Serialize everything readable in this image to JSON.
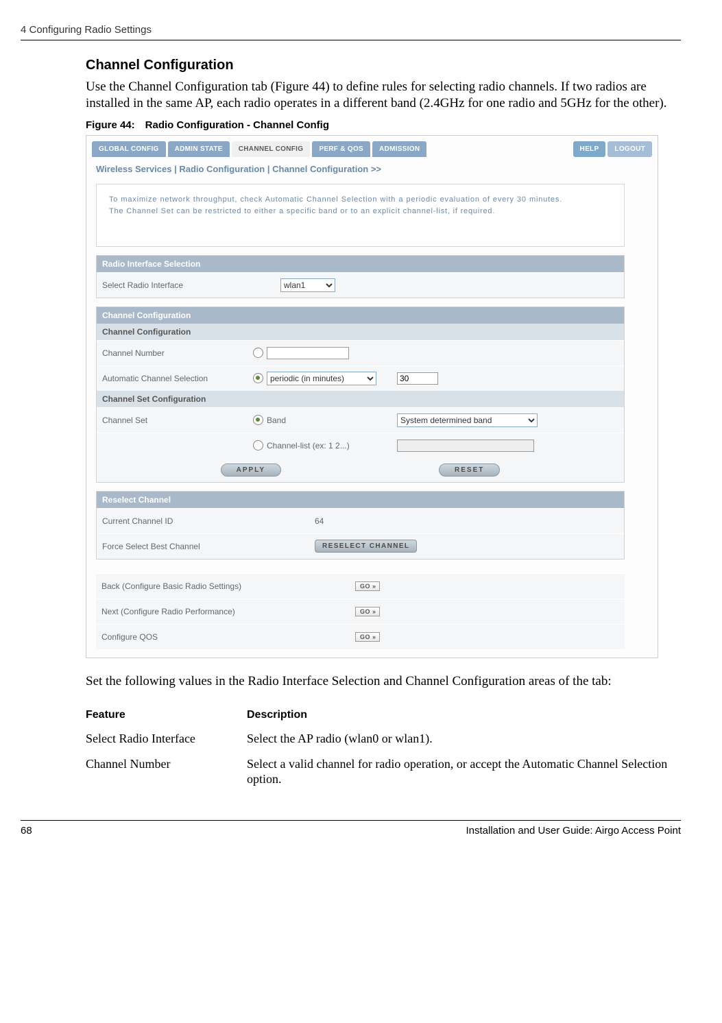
{
  "header": {
    "chapter": "4  Configuring Radio Settings"
  },
  "section": {
    "title": "Channel Configuration",
    "para1": "Use the Channel Configuration tab (Figure 44) to define rules for selecting radio channels. If two radios are installed in the same AP, each radio operates in a different band (2.4GHz for one radio and 5GHz for the other).",
    "figcap": "Figure 44: Radio Configuration - Channel Config"
  },
  "ui": {
    "tabs": {
      "global": "GLOBAL CONFIG",
      "admin": "ADMIN STATE",
      "channel": "CHANNEL CONFIG",
      "perf": "PERF & QOS",
      "admission": "ADMISSION",
      "help": "HELP",
      "logout": "LOGOUT"
    },
    "breadcrumb": "Wireless Services | Radio Configuration | Channel Configuration  >>",
    "infobox": "To maximize network throughput, check Automatic Channel Selection with a periodic evaluation of every 30 minutes. The Channel Set can be restricted to either a specific band or to an explicit channel-list, if required.",
    "radio_if": {
      "head": "Radio Interface Selection",
      "label": "Select Radio Interface",
      "value": "wlan1"
    },
    "chancfg": {
      "head": "Channel Configuration",
      "sub1": "Channel Configuration",
      "row_channel_number": "Channel Number",
      "row_auto_sel": "Automatic Channel Selection",
      "auto_mode": "periodic (in minutes)",
      "auto_value": "30",
      "sub2": "Channel Set Configuration",
      "row_channel_set": "Channel Set",
      "band_label": "Band",
      "band_value": "System determined band",
      "chanlist_label": "Channel-list (ex: 1 2...)",
      "apply": "APPLY",
      "reset": "RESET"
    },
    "reselect": {
      "head": "Reselect Channel",
      "cur_label": "Current Channel ID",
      "cur_value": "64",
      "force_label": "Force Select Best Channel",
      "btn": "RESELECT CHANNEL"
    },
    "nav": {
      "back": "Back (Configure Basic Radio Settings)",
      "next": "Next (Configure Radio Performance)",
      "qos": "Configure QOS",
      "go": "GO »"
    }
  },
  "post": {
    "para": "Set the following values in the Radio Interface Selection and Channel Configuration areas of the tab:"
  },
  "table": {
    "h1": "Feature",
    "h2": "Description",
    "r1c1": "Select Radio Interface",
    "r1c2": "Select the AP radio (wlan0 or wlan1).",
    "r2c1": "Channel Number",
    "r2c2": "Select a valid channel for radio operation, or accept the Automatic Channel Selection option."
  },
  "footer": {
    "page": "68",
    "title": "Installation and User Guide: Airgo Access Point"
  }
}
